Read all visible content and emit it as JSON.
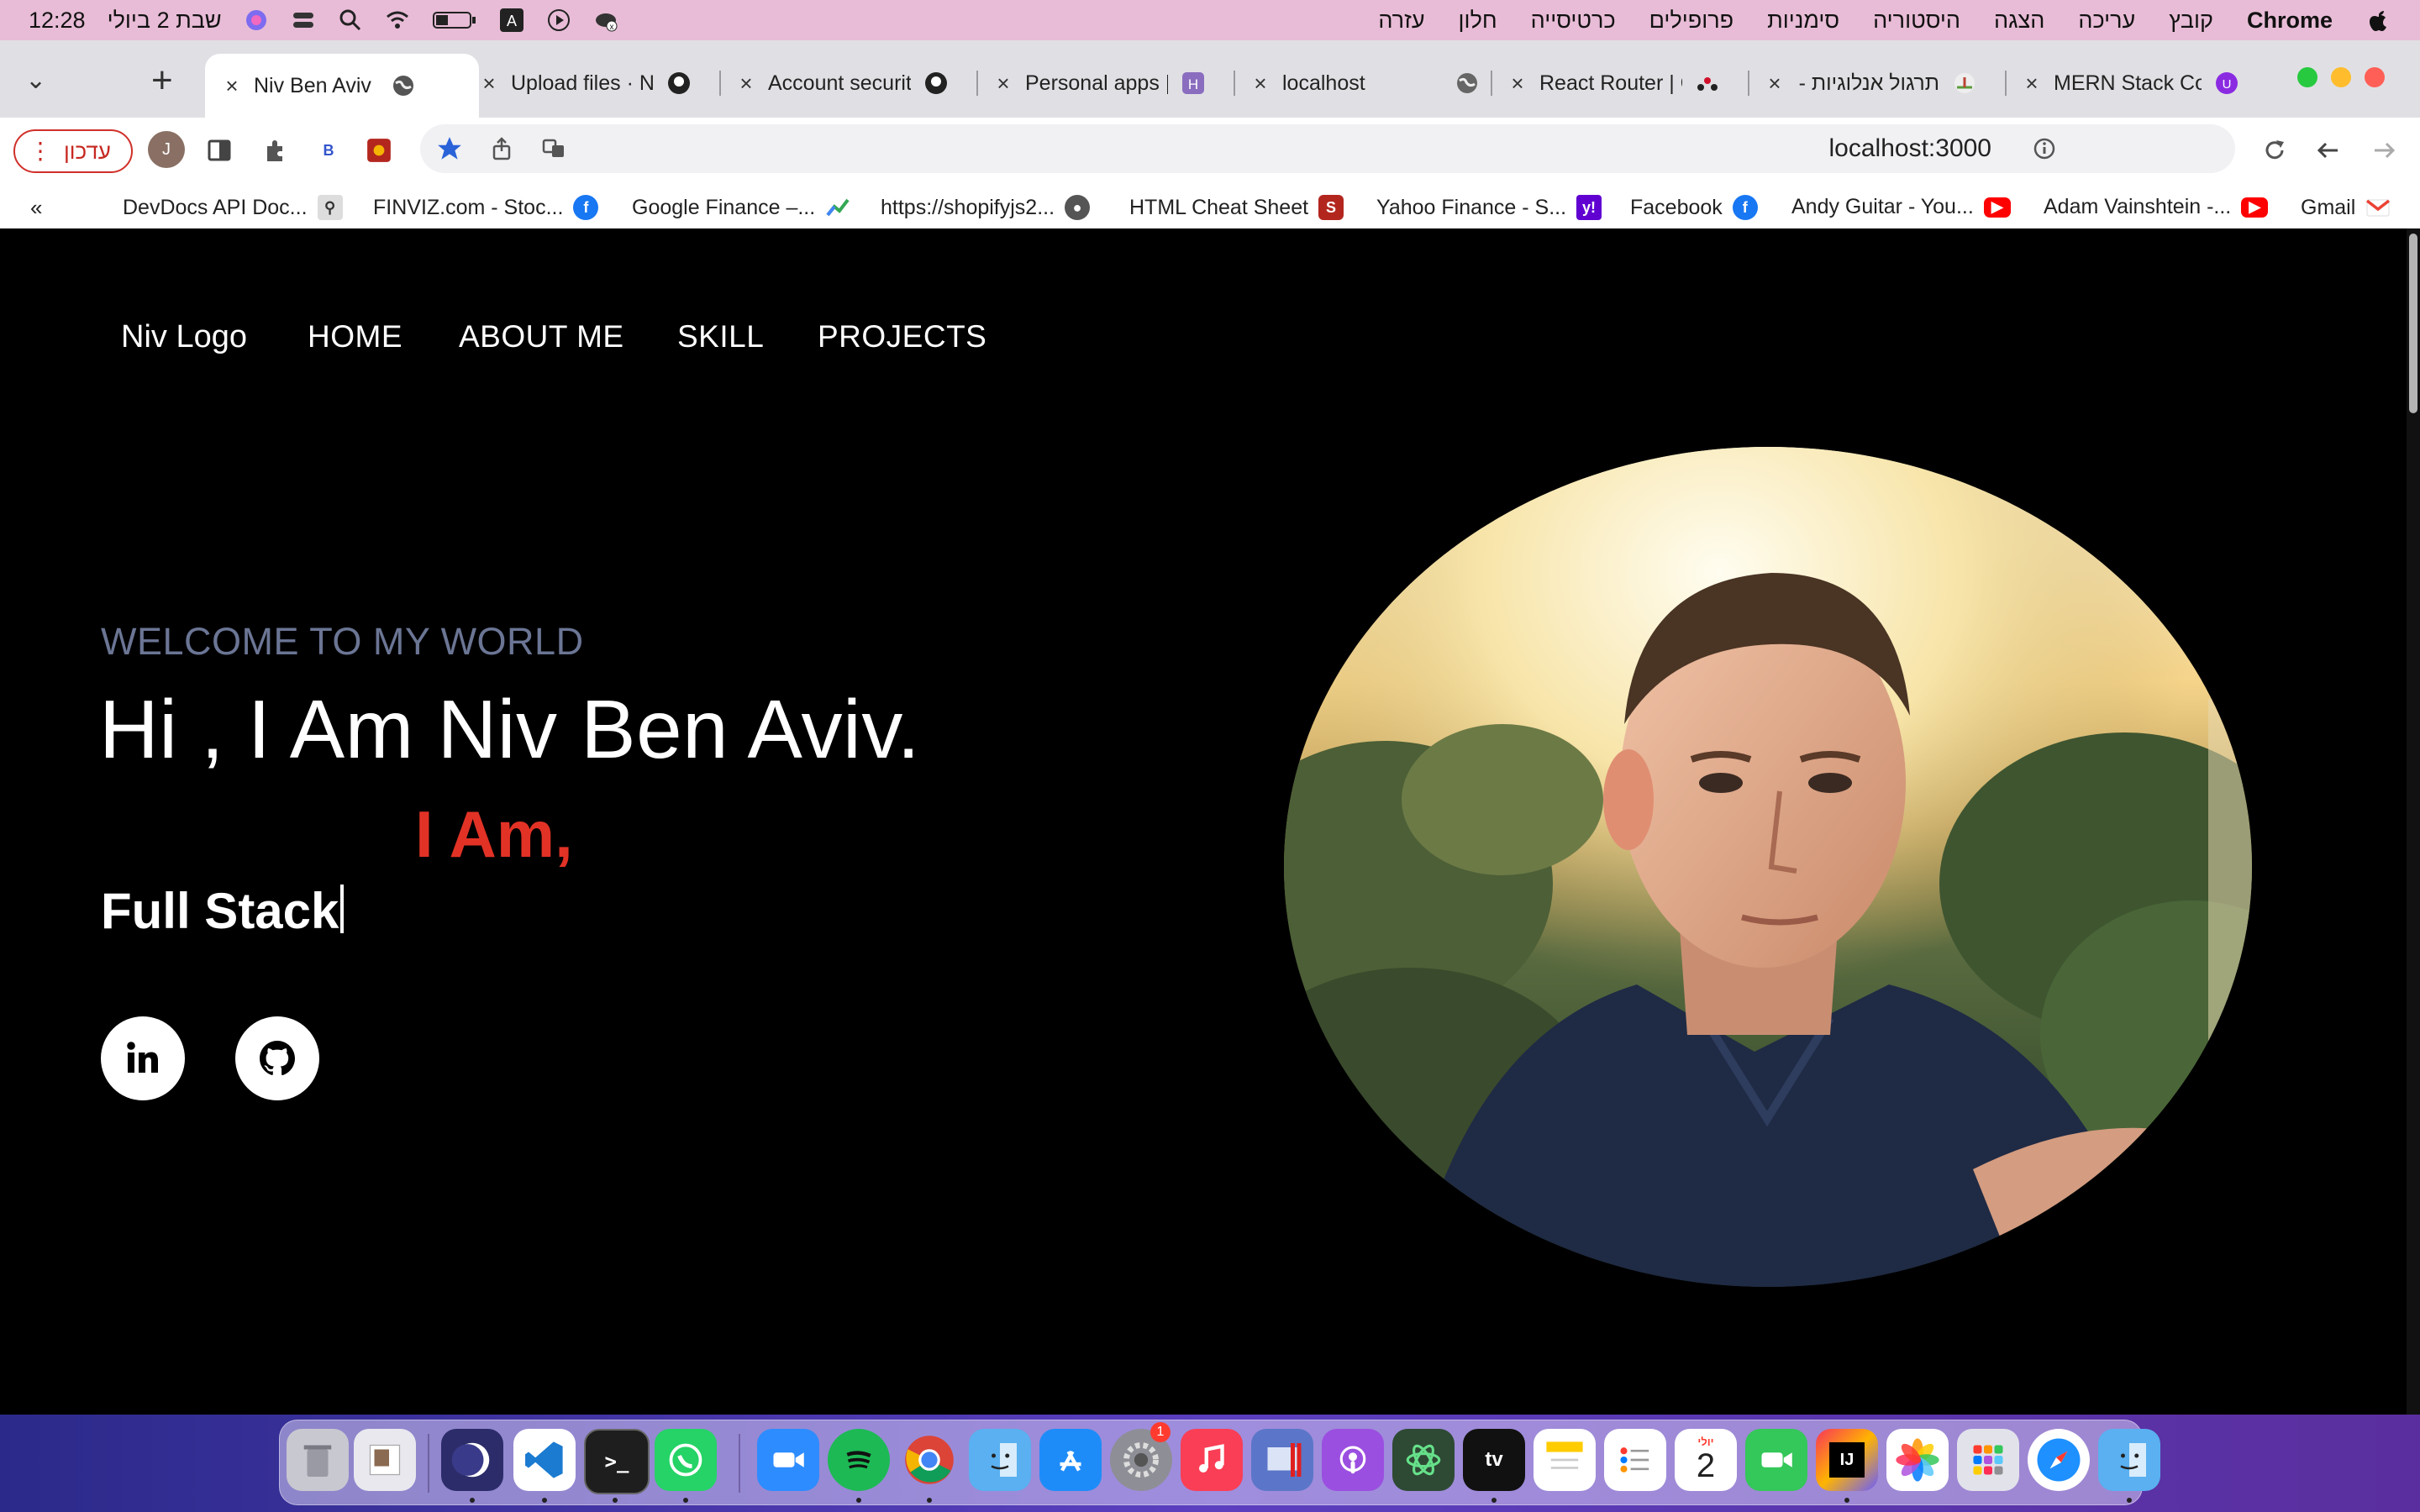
{
  "menubar": {
    "time": "12:28",
    "date": "שבת 2 ביולי",
    "app": "Chrome",
    "items": [
      "קובץ",
      "עריכה",
      "הצגה",
      "היסטוריה",
      "סימניות",
      "פרופילים",
      "כרטיסייה",
      "חלון",
      "עזרה"
    ]
  },
  "tabs": [
    {
      "label": "Niv Ben Aviv Pr",
      "active": true
    },
    {
      "label": "Upload files · N"
    },
    {
      "label": "Account securit"
    },
    {
      "label": "Personal apps |"
    },
    {
      "label": "localhost"
    },
    {
      "label": "React Router | C"
    },
    {
      "label": "תרגול אנלוגיות -"
    },
    {
      "label": "MERN Stack Co"
    }
  ],
  "toolbar": {
    "update_label": "עדכון",
    "profile_initial": "J",
    "url": "localhost:3000"
  },
  "bookmarks": [
    {
      "label": "DevDocs API Doc...",
      "icon": "search-icon"
    },
    {
      "label": "FINVIZ.com - Stoc...",
      "icon": "facebook-icon"
    },
    {
      "label": "Google Finance –...",
      "icon": "finance-icon"
    },
    {
      "label": "https://shopifyjs2...",
      "icon": "globe-icon"
    },
    {
      "label": "HTML Cheat Sheet",
      "icon": "html-icon"
    },
    {
      "label": "Yahoo Finance - S...",
      "icon": "yahoo-icon"
    },
    {
      "label": "Facebook",
      "icon": "facebook-icon"
    },
    {
      "label": "Andy Guitar - You...",
      "icon": "youtube-icon"
    },
    {
      "label": "Adam Vainshtein -...",
      "icon": "youtube-icon"
    },
    {
      "label": "Gmail",
      "icon": "gmail-icon"
    }
  ],
  "page": {
    "logo": "Niv Logo",
    "nav": [
      "HOME",
      "ABOUT ME",
      "SKILL",
      "PROJECTS"
    ],
    "tagline": "WELCOME TO MY WORLD",
    "title": "Hi , I Am Niv Ben Aviv.",
    "iam": "I Am,",
    "role": "Full Stack",
    "social": [
      "linkedin-icon",
      "github-icon"
    ]
  },
  "dock": {
    "calendar_month": "יולי",
    "calendar_day": "2",
    "settings_badge": "1"
  },
  "colors": {
    "accent_red": "#e23226",
    "tagline_gray": "#6b7594",
    "menubar_pink": "#e8bcd6"
  }
}
